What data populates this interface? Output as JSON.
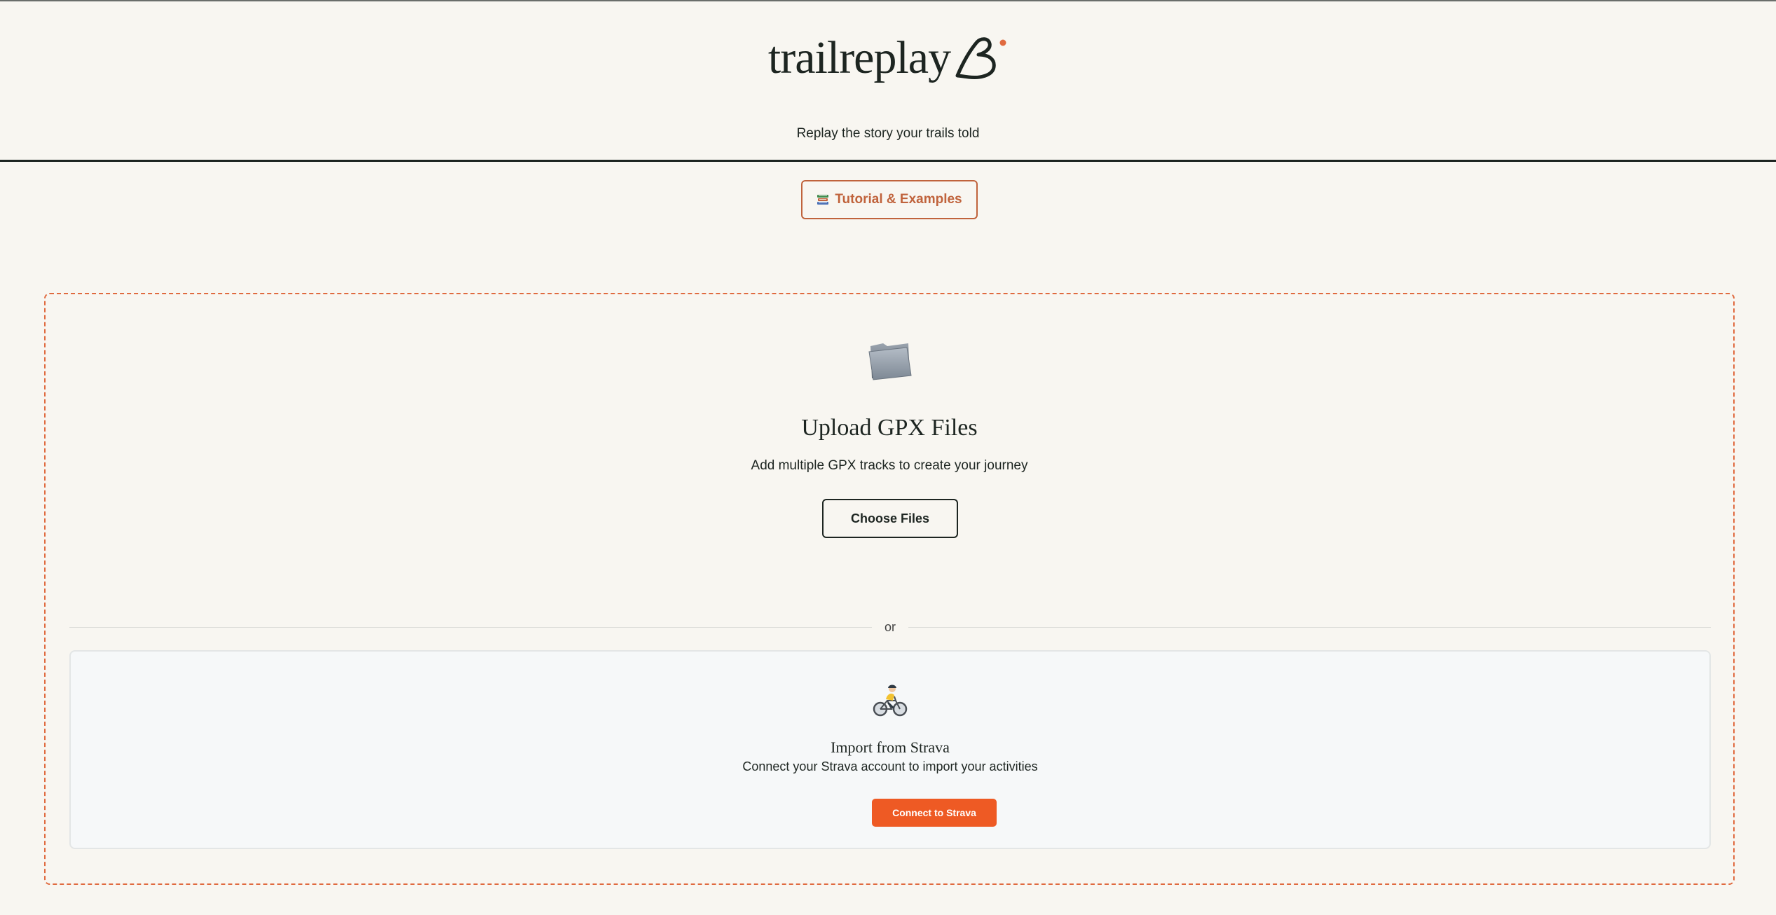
{
  "header": {
    "logo_text": "trailreplay",
    "tagline": "Replay the story your trails told"
  },
  "tutorial": {
    "label": "Tutorial & Examples",
    "icon": "books-icon"
  },
  "upload": {
    "icon": "folder-icon",
    "title": "Upload GPX Files",
    "subtitle": "Add multiple GPX tracks to create your journey",
    "choose_label": "Choose Files"
  },
  "divider": {
    "text": "or"
  },
  "strava": {
    "icon": "cyclist-icon",
    "title": "Import from Strava",
    "subtitle": "Connect your Strava account to import your activities",
    "connect_label": "Connect to Strava"
  },
  "colors": {
    "background": "#f8f6f1",
    "text": "#1d2521",
    "accent": "#e06a3f",
    "tutorial_accent": "#c0633c",
    "strava_orange": "#ee5a24",
    "strava_card_bg": "#f6f8f9"
  }
}
